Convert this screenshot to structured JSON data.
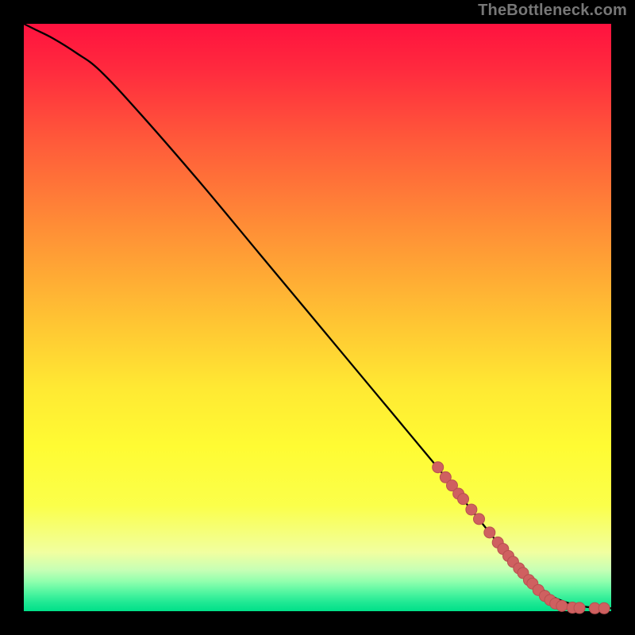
{
  "attribution": "TheBottleneck.com",
  "colors": {
    "page_bg": "#000000",
    "curve": "#000000",
    "marker_fill": "#cf6060",
    "marker_stroke": "#b85050",
    "gradient_top": "#ff123f",
    "gradient_mid": "#fffb33",
    "gradient_bottom": "#00e089"
  },
  "chart_data": {
    "type": "line",
    "title": "",
    "xlabel": "",
    "ylabel": "",
    "xlim": [
      0,
      100
    ],
    "ylim": [
      0,
      100
    ],
    "grid": false,
    "legend": false,
    "series": [
      {
        "name": "bottleneck-curve",
        "x": [
          0,
          2,
          5,
          9,
          13,
          20,
          30,
          40,
          50,
          60,
          70,
          74,
          78,
          82,
          85,
          88,
          90,
          93,
          96,
          100
        ],
        "y": [
          100,
          99,
          97.5,
          95,
          92,
          84.5,
          73,
          61,
          49,
          37,
          25,
          20,
          15,
          10,
          6.5,
          4,
          2.5,
          1.3,
          0.7,
          0.5
        ]
      }
    ],
    "markers": [
      {
        "x": 70.5,
        "y": 24.5
      },
      {
        "x": 71.8,
        "y": 22.8
      },
      {
        "x": 72.9,
        "y": 21.4
      },
      {
        "x": 74.0,
        "y": 20.0
      },
      {
        "x": 74.8,
        "y": 19.1
      },
      {
        "x": 76.2,
        "y": 17.3
      },
      {
        "x": 77.5,
        "y": 15.7
      },
      {
        "x": 79.3,
        "y": 13.4
      },
      {
        "x": 80.7,
        "y": 11.7
      },
      {
        "x": 81.6,
        "y": 10.6
      },
      {
        "x": 82.5,
        "y": 9.4
      },
      {
        "x": 83.3,
        "y": 8.4
      },
      {
        "x": 84.3,
        "y": 7.3
      },
      {
        "x": 85.0,
        "y": 6.5
      },
      {
        "x": 86.0,
        "y": 5.3
      },
      {
        "x": 86.6,
        "y": 4.7
      },
      {
        "x": 87.6,
        "y": 3.6
      },
      {
        "x": 88.7,
        "y": 2.6
      },
      {
        "x": 89.6,
        "y": 1.9
      },
      {
        "x": 90.5,
        "y": 1.3
      },
      {
        "x": 91.6,
        "y": 0.9
      },
      {
        "x": 93.4,
        "y": 0.6
      },
      {
        "x": 94.6,
        "y": 0.55
      },
      {
        "x": 97.2,
        "y": 0.5
      },
      {
        "x": 98.8,
        "y": 0.5
      }
    ],
    "marker_radius_px": 7
  }
}
